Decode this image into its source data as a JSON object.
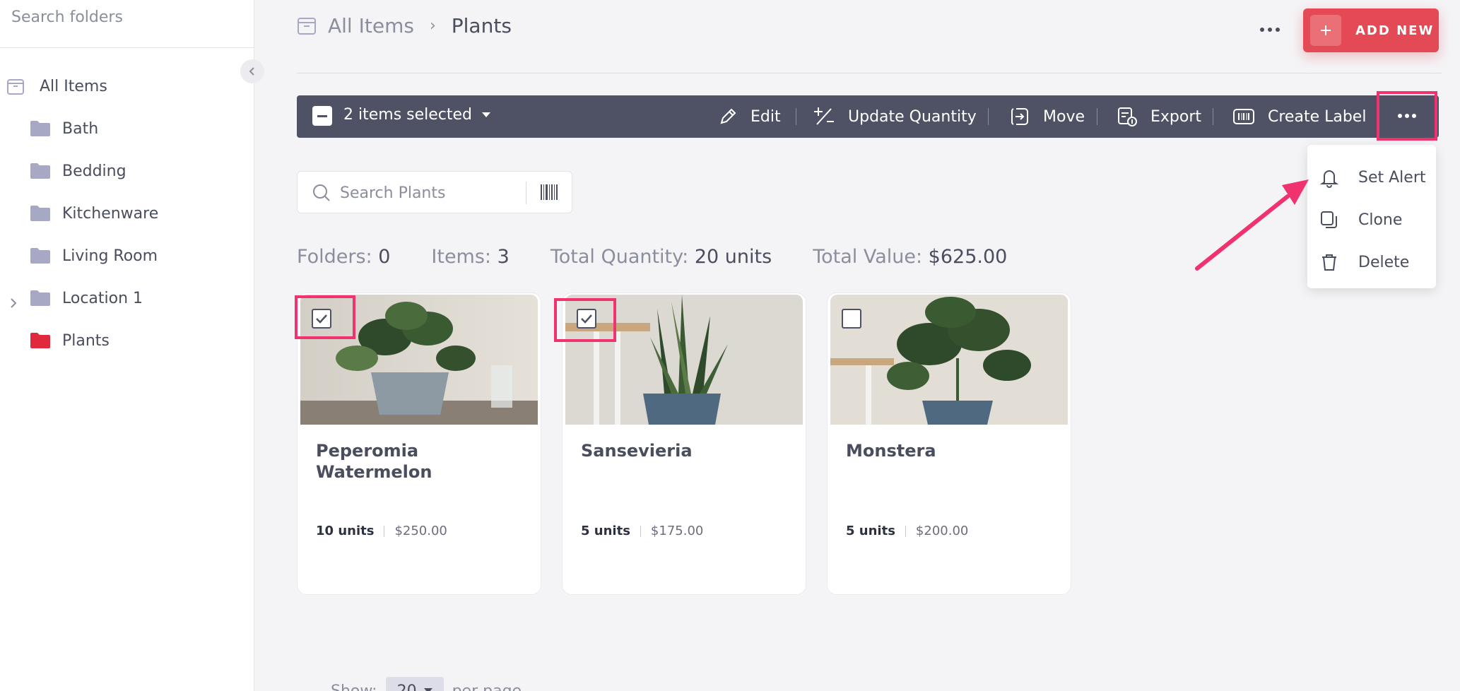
{
  "sidebar": {
    "search_placeholder": "Search folders",
    "root": {
      "label": "All Items"
    },
    "folders": [
      {
        "label": "Bath",
        "color": "#a7a9c4"
      },
      {
        "label": "Bedding",
        "color": "#a7a9c4"
      },
      {
        "label": "Kitchenware",
        "color": "#a7a9c4"
      },
      {
        "label": "Living Room",
        "color": "#a7a9c4"
      },
      {
        "label": "Location 1",
        "color": "#a7a9c4"
      },
      {
        "label": "Plants",
        "color": "#e0293b"
      }
    ]
  },
  "header": {
    "breadcrumb_root": "All Items",
    "breadcrumb_sep": "›",
    "breadcrumb_current": "Plants",
    "add_new_label": "ADD NEW"
  },
  "selection_bar": {
    "selected_label": "2 items selected",
    "actions": [
      {
        "label": "Edit",
        "icon": "pencil-icon"
      },
      {
        "label": "Update Quantity",
        "icon": "plus-minus-icon"
      },
      {
        "label": "Move",
        "icon": "move-icon"
      },
      {
        "label": "Export",
        "icon": "export-icon"
      },
      {
        "label": "Create Label",
        "icon": "barcode-icon"
      }
    ]
  },
  "more_menu": {
    "items": [
      {
        "label": "Set Alert",
        "icon": "bell-icon"
      },
      {
        "label": "Clone",
        "icon": "copy-icon"
      },
      {
        "label": "Delete",
        "icon": "trash-icon"
      }
    ]
  },
  "search": {
    "placeholder": "Search Plants"
  },
  "stats": {
    "folders_label": "Folders:",
    "folders_value": "0",
    "items_label": "Items:",
    "items_value": "3",
    "qty_label": "Total Quantity:",
    "qty_value": "20 units",
    "value_label": "Total Value:",
    "value_value": "$625.00"
  },
  "items": [
    {
      "name": "Peperomia Watermelon",
      "units": "10 units",
      "price": "$250.00",
      "selected": true
    },
    {
      "name": "Sansevieria",
      "units": "5 units",
      "price": "$175.00",
      "selected": true
    },
    {
      "name": "Monstera",
      "units": "5 units",
      "price": "$200.00",
      "selected": false
    }
  ],
  "pager": {
    "show_label": "Show:",
    "per_page_value": "20",
    "per_page_label": "per page"
  },
  "colors": {
    "accent": "#e44a55",
    "highlight": "#f0336f",
    "toolbar": "#4e5264"
  }
}
